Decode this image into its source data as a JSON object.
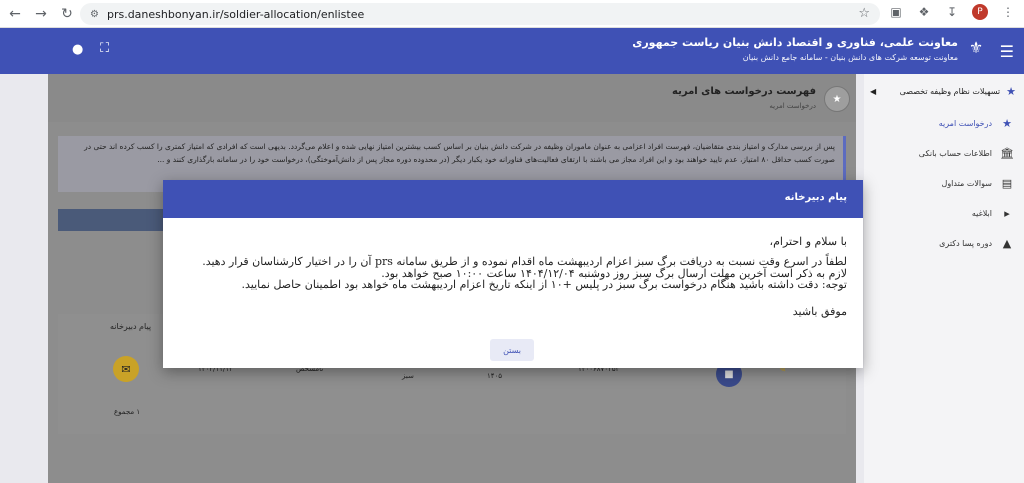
{
  "browser": {
    "url": "prs.daneshbonyan.ir/soldier-allocation/enlistee",
    "profile_initial": "P"
  },
  "header": {
    "title": "معاونت علمی، فناوری و اقتصاد دانش بنیان ریاست جمهوری",
    "subtitle": "معاونت توسعه شرکت های دانش بنیان - سامانه جامع دانش بنیان"
  },
  "sidebar": {
    "section": "تسهیلات نظام وظیفه تخصصی",
    "items": [
      {
        "label": "درخواست امریه",
        "icon": "medal-icon",
        "active": true
      },
      {
        "label": "اطلاعات حساب بانکی",
        "icon": "bank-icon",
        "active": false
      },
      {
        "label": "سوالات متداول",
        "icon": "faq-icon",
        "active": false
      },
      {
        "label": "ابلاغیه",
        "icon": "megaphone-icon",
        "active": false
      },
      {
        "label": "دوره پسا دکتری",
        "icon": "graduation-icon",
        "active": false
      }
    ]
  },
  "page": {
    "title": "فهرست درخواست های امریه",
    "breadcrumb": "درخواست امریه",
    "notice": "پس از بررسی مدارک و امتیاز بندی متقاضیان، فهرست افراد اعزامی به عنوان ماموران وظیفه در شرکت دانش بنیان بر اساس کسب بیشترین امتیاز نهایی شده و اعلام می‌گردد. بدیهی است که افرادی که امتیاز کمتری را کسب کرده اند حتی در صورت کسب حداقل ۸۰ امتیاز، عدم تایید خواهند بود و این افراد مجاز می باشند با ارتقای فعالیت‌های فناورانه خود یکبار دیگر (در محدوده دوره مجاز پس از دانش‌آموختگی)، درخواست خود را در سامانه بارگذاری کنند و ..."
  },
  "table": {
    "column_message": "پیام دبیرخانه",
    "row": {
      "date": "۱۴۰۴/۱۱/۱۳",
      "status": "نامشخص",
      "color": "سبز",
      "year": "۱۴۰۵",
      "code": "۱۴۰۰۶۸۷۰۳۵۳"
    },
    "total": "۱ مجموع"
  },
  "modal": {
    "title": "پیام دبیرخانه",
    "greeting": "با سلام و احترام،",
    "line1": "لطفاً در اسرع وقت نسبت به دریافت برگ سبز اعزام اردیبهشت ماه اقدام نموده و از طریق سامانه prs آن را در اختیار کارشناسان قرار دهید.",
    "line2": "لازم به ذکر است آخرین مهلت ارسال برگ سبز روز دوشنبه ۱۴۰۴/۱۲/۰۴ ساعت ۱۰:۰۰ صبح خواهد بود.",
    "line3": "توجه: دقت داشته باشید هنگام درخواست برگ سبز در پلیس +۱۰ از اینکه تاریخ اعزام اردیبهشت ماه خواهد بود اطمینان حاصل نمایید.",
    "closing": "موفق باشید",
    "close_label": "بستن"
  }
}
